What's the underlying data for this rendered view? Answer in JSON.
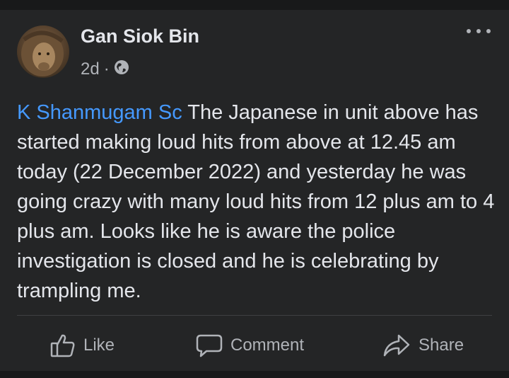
{
  "post": {
    "author": "Gan Siok Bin",
    "time": "2d",
    "separator": "·",
    "audience_icon": "globe-icon",
    "mention": "K Shanmugam Sc",
    "text": " The Japanese in unit above has started making loud hits from above at 12.45 am today (22 December 2022) and yesterday he was going crazy with many loud hits from 12 plus am to 4 plus am. Looks like he is aware the police investigation is closed and he is celebrating by trampling me."
  },
  "actions": {
    "like_label": "Like",
    "comment_label": "Comment",
    "share_label": "Share"
  },
  "colors": {
    "background": "#242526",
    "text": "#e4e6eb",
    "secondary_text": "#b0b3b8",
    "mention": "#4599ff"
  }
}
